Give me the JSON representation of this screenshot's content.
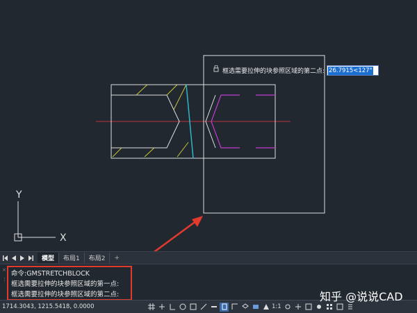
{
  "viewport": {
    "tooltip_prompt": "框选需要拉伸的块参照区域的第二点:",
    "tooltip_value": "26.7915<127°",
    "ucs_x_label": "X",
    "ucs_y_label": "Y"
  },
  "tabs": {
    "items": [
      {
        "label": "模型",
        "active": true
      },
      {
        "label": "布局1",
        "active": false
      },
      {
        "label": "布局2",
        "active": false
      }
    ],
    "add_label": "+"
  },
  "command_line": {
    "lines": [
      "命令:GMSTRETCHBLOCK",
      "框选需要拉伸的块参照区域的第一点:",
      "框选需要拉伸的块参照区域的第二点:"
    ]
  },
  "status_bar": {
    "coordinates": "1714.3043, 1215.5418, 0.0000",
    "scale": "1:1"
  },
  "watermark": "知乎 @说说CAD",
  "colors": {
    "background": "#212830",
    "highlight": "#e23b2e",
    "magenta": "#c23bd4",
    "yellow": "#c8c83c",
    "cyan": "#2bb8c8",
    "centerline": "#c0303a"
  }
}
